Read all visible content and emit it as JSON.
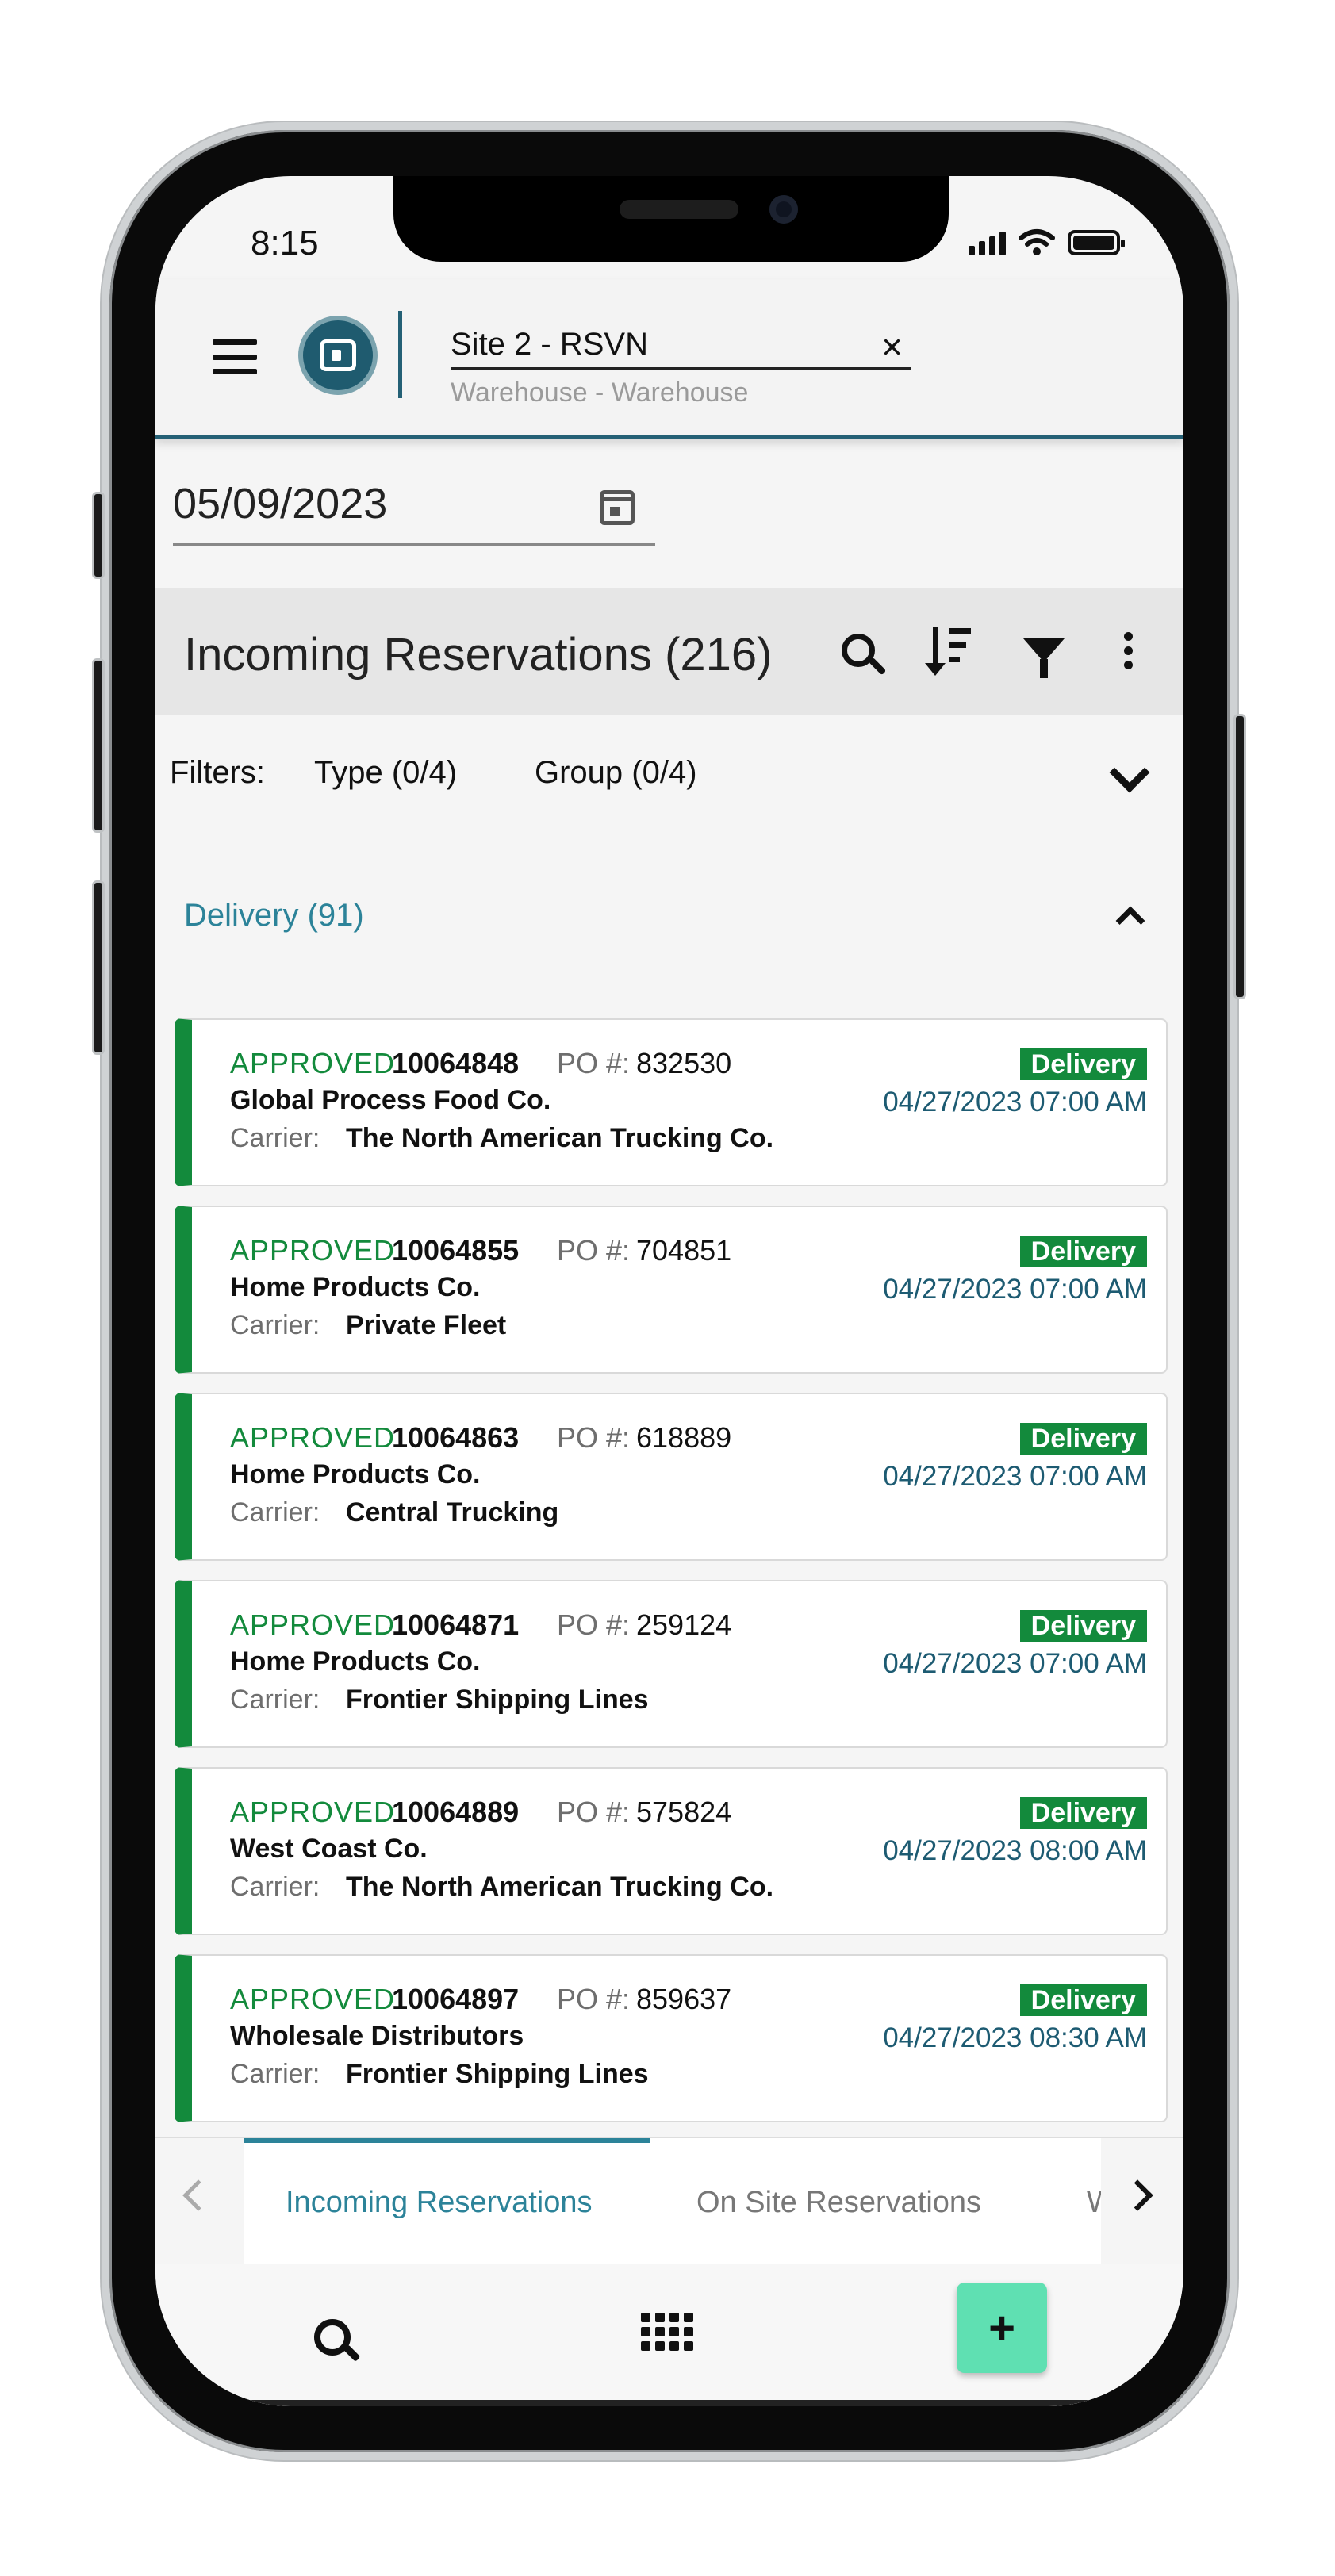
{
  "status_bar": {
    "time": "8:15"
  },
  "header": {
    "site_value": "Site 2 - RSVN",
    "site_subtitle": "Warehouse - Warehouse",
    "clear_symbol": "×",
    "icons": {
      "menu": "hamburger-menu-icon",
      "logo": "company-logo",
      "clear": "close-icon"
    }
  },
  "date_picker": {
    "value": "05/09/2023",
    "icon": "calendar-icon"
  },
  "list_header": {
    "title": "Incoming Reservations (216)",
    "icons": [
      "search-icon",
      "sort-icon",
      "filter-icon",
      "more-vert-icon"
    ]
  },
  "filters": {
    "label": "Filters:",
    "type": "Type (0/4)",
    "group": "Group (0/4)"
  },
  "group": {
    "title": "Delivery (91)"
  },
  "cards": [
    {
      "status": "APPROVED",
      "id": "10064848",
      "po_label": "PO #:",
      "po": "832530",
      "company": "Global Process Food Co.",
      "carrier_label": "Carrier:",
      "carrier": "The North American Trucking Co.",
      "badge": "Delivery",
      "datetime": "04/27/2023 07:00 AM"
    },
    {
      "status": "APPROVED",
      "id": "10064855",
      "po_label": "PO #:",
      "po": "704851",
      "company": "Home Products Co.",
      "carrier_label": "Carrier:",
      "carrier": "Private Fleet",
      "badge": "Delivery",
      "datetime": "04/27/2023 07:00 AM"
    },
    {
      "status": "APPROVED",
      "id": "10064863",
      "po_label": "PO #:",
      "po": "618889",
      "company": "Home Products Co.",
      "carrier_label": "Carrier:",
      "carrier": "Central Trucking",
      "badge": "Delivery",
      "datetime": "04/27/2023 07:00 AM"
    },
    {
      "status": "APPROVED",
      "id": "10064871",
      "po_label": "PO #:",
      "po": "259124",
      "company": "Home Products Co.",
      "carrier_label": "Carrier:",
      "carrier": "Frontier Shipping Lines",
      "badge": "Delivery",
      "datetime": "04/27/2023 07:00 AM"
    },
    {
      "status": "APPROVED",
      "id": "10064889",
      "po_label": "PO #:",
      "po": "575824",
      "company": "West Coast Co.",
      "carrier_label": "Carrier:",
      "carrier": "The North American Trucking Co.",
      "badge": "Delivery",
      "datetime": "04/27/2023 08:00 AM"
    },
    {
      "status": "APPROVED",
      "id": "10064897",
      "po_label": "PO #:",
      "po": "859637",
      "company": "Wholesale Distributors",
      "carrier_label": "Carrier:",
      "carrier": "Frontier Shipping Lines",
      "badge": "Delivery",
      "datetime": "04/27/2023 08:30 AM"
    }
  ],
  "tabs": {
    "items": [
      "Incoming Reservations",
      "On Site Reservations",
      "W"
    ],
    "active": "Incoming Reservations"
  },
  "bottom_nav": {
    "add_label": "+",
    "icons": [
      "search-icon",
      "apps-grid-icon",
      "add-icon"
    ]
  },
  "colors": {
    "accent_teal": "#2c8399",
    "header_border": "#246075",
    "approved_green": "#138a3c",
    "datetime_blue": "#1d5b72",
    "fab_mint": "#5fe0b2"
  }
}
